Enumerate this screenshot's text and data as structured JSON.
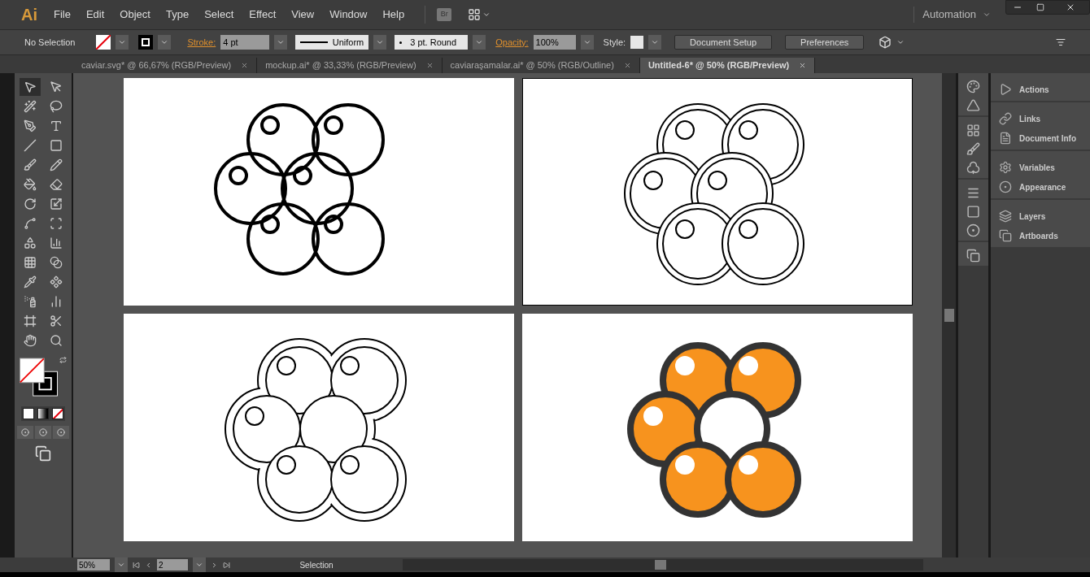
{
  "app_logo": "Ai",
  "menu": [
    "File",
    "Edit",
    "Object",
    "Type",
    "Select",
    "Effect",
    "View",
    "Window",
    "Help"
  ],
  "bridge_button": "Br",
  "workspace": "Automation",
  "control_bar": {
    "selection": "No Selection",
    "stroke_label": "Stroke:",
    "stroke_weight": "4 pt",
    "profile": "Uniform",
    "brush": "3 pt. Round",
    "opacity_label": "Opacity:",
    "opacity": "100%",
    "style_label": "Style:",
    "buttons": [
      "Document Setup",
      "Preferences"
    ]
  },
  "tabs": [
    {
      "label": "caviar.svg* @ 66,67% (RGB/Preview)",
      "selected": false
    },
    {
      "label": "mockup.ai* @ 33,33% (RGB/Preview)",
      "selected": false
    },
    {
      "label": "caviaraşamalar.ai* @ 50% (RGB/Outline)",
      "selected": false
    },
    {
      "label": "Untitled-6* @ 50% (RGB/Preview)",
      "selected": true
    }
  ],
  "tools": [
    {
      "selected": true
    },
    {
      "selected": false
    },
    {
      "selected": false
    },
    {
      "selected": false
    },
    {
      "selected": false
    },
    {
      "selected": false
    },
    {
      "selected": false
    },
    {
      "selected": false
    },
    {
      "selected": false
    },
    {
      "selected": false
    },
    {
      "selected": false
    },
    {
      "selected": false
    },
    {
      "selected": false
    },
    {
      "selected": false
    },
    {
      "selected": false
    },
    {
      "selected": false
    },
    {
      "selected": false
    },
    {
      "selected": false
    },
    {
      "selected": false
    },
    {
      "selected": false
    },
    {
      "selected": false
    },
    {
      "selected": false
    },
    {
      "selected": false
    },
    {
      "selected": false
    },
    {
      "selected": false
    },
    {
      "selected": false
    },
    {
      "selected": false
    },
    {
      "selected": false
    }
  ],
  "artboards": [
    {
      "kind": "single",
      "selected": false
    },
    {
      "kind": "double",
      "selected": true
    },
    {
      "kind": "merged",
      "selected": false
    },
    {
      "kind": "filled",
      "selected": false
    }
  ],
  "panels": [
    [
      {
        "label": "Actions"
      }
    ],
    [
      {
        "label": "Links"
      },
      {
        "label": "Document Info"
      }
    ],
    [
      {
        "label": "Variables"
      },
      {
        "label": "Appearance"
      }
    ],
    [
      {
        "label": "Layers"
      },
      {
        "label": "Artboards"
      }
    ]
  ],
  "status_bar": {
    "zoom": "50%",
    "artboard": "2",
    "tool": "Selection"
  }
}
